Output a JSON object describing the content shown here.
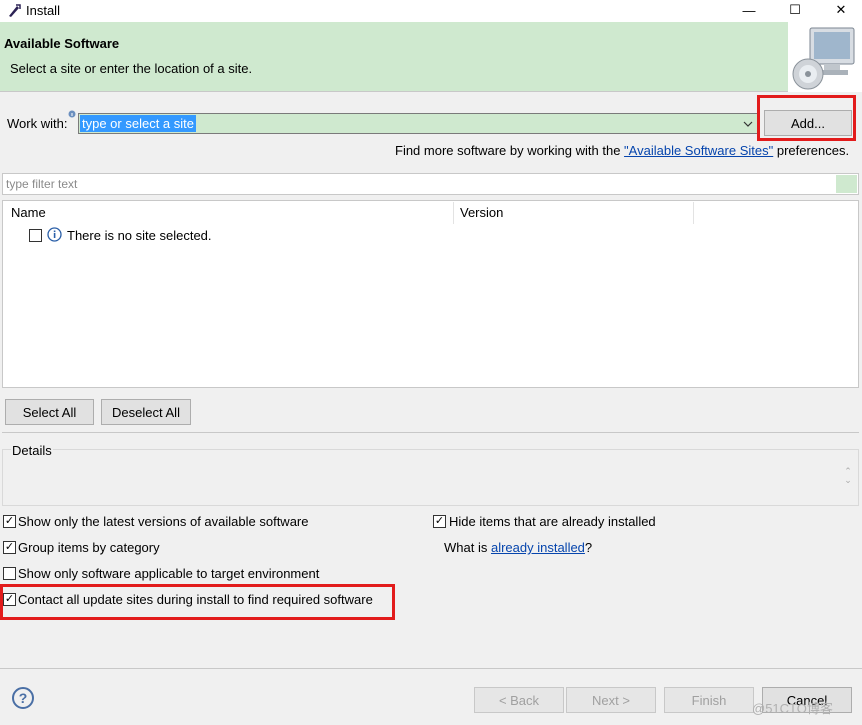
{
  "window": {
    "title": "Install",
    "minimize": "—",
    "maximize": "☐",
    "close": "✕"
  },
  "banner": {
    "title": "Available Software",
    "subtitle": "Select a site or enter the location of a site."
  },
  "work_with": {
    "label": "Work with:",
    "value": "type or select a site",
    "add_label": "Add...",
    "find_more_prefix": "Find more software by working with the ",
    "find_more_link": "\"Available Software Sites\"",
    "find_more_suffix": " preferences."
  },
  "filter": {
    "placeholder": "type filter text"
  },
  "table": {
    "columns": [
      "Name",
      "Version"
    ],
    "rows": [
      {
        "label": "There is no site selected.",
        "checked": false
      }
    ]
  },
  "buttons": {
    "select_all": "Select All",
    "deselect_all": "Deselect All"
  },
  "details": {
    "label": "Details"
  },
  "options": [
    {
      "label": "Show only the latest versions of available software",
      "checked": true
    },
    {
      "label": "Group items by category",
      "checked": true
    },
    {
      "label": "Show only software applicable to target environment",
      "checked": false
    },
    {
      "label": "Contact all update sites during install to find required software",
      "checked": true
    },
    {
      "label": "Hide items that are already installed",
      "checked": true
    }
  ],
  "what_is": {
    "prefix": "What is ",
    "link": "already installed",
    "suffix": "?"
  },
  "footer": {
    "help": "?",
    "back": "< Back",
    "next": "Next >",
    "finish": "Finish",
    "cancel": "Cancel",
    "watermark": "@51CTO博客"
  },
  "colors": {
    "banner": "#cfe9cf",
    "highlight": "#e21b1b",
    "selection": "#3399ff",
    "link": "#0645ad"
  }
}
